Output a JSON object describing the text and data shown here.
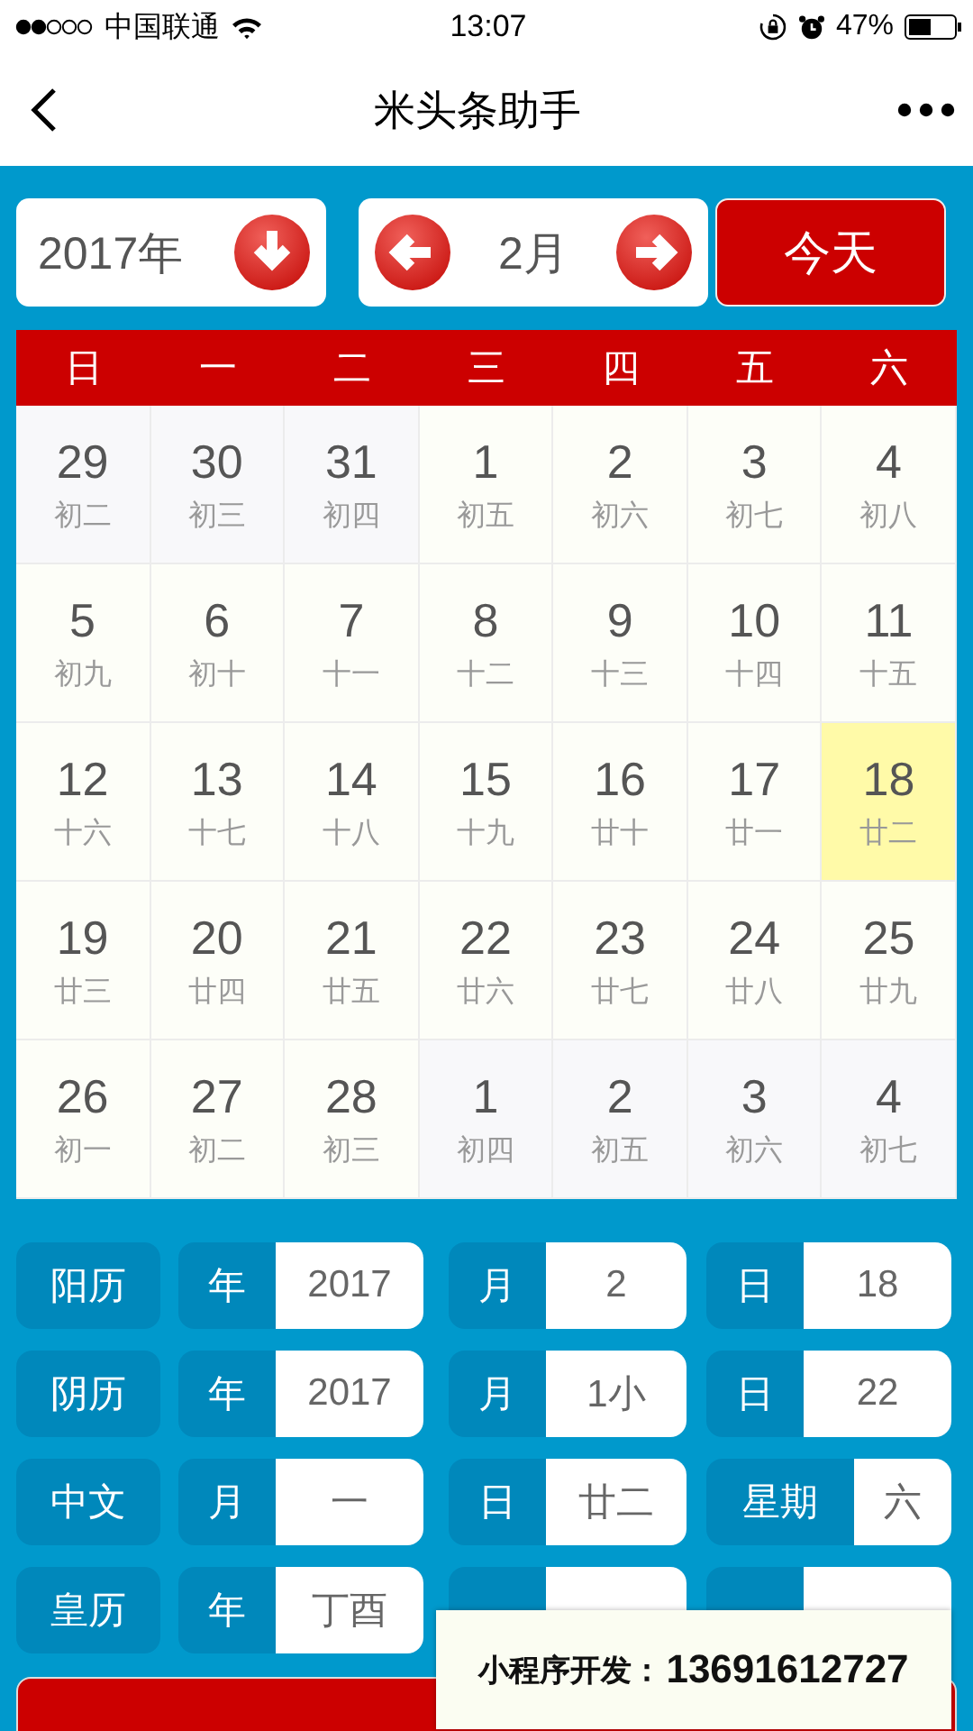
{
  "status_bar": {
    "carrier": "中国联通",
    "time": "13:07",
    "battery": "47%"
  },
  "nav": {
    "title": "米头条助手"
  },
  "controls": {
    "year": "2017年",
    "month": "2月",
    "today_button": "今天"
  },
  "weekdays": [
    "日",
    "一",
    "二",
    "三",
    "四",
    "五",
    "六"
  ],
  "days": [
    {
      "day": "29",
      "lunar": "初二",
      "kind": "other",
      "selected": false
    },
    {
      "day": "30",
      "lunar": "初三",
      "kind": "other",
      "selected": false
    },
    {
      "day": "31",
      "lunar": "初四",
      "kind": "other",
      "selected": false
    },
    {
      "day": "1",
      "lunar": "初五",
      "kind": "current",
      "selected": false
    },
    {
      "day": "2",
      "lunar": "初六",
      "kind": "current",
      "selected": false
    },
    {
      "day": "3",
      "lunar": "初七",
      "kind": "current",
      "selected": false
    },
    {
      "day": "4",
      "lunar": "初八",
      "kind": "current",
      "selected": false
    },
    {
      "day": "5",
      "lunar": "初九",
      "kind": "current",
      "selected": false
    },
    {
      "day": "6",
      "lunar": "初十",
      "kind": "current",
      "selected": false
    },
    {
      "day": "7",
      "lunar": "十一",
      "kind": "current",
      "selected": false
    },
    {
      "day": "8",
      "lunar": "十二",
      "kind": "current",
      "selected": false
    },
    {
      "day": "9",
      "lunar": "十三",
      "kind": "current",
      "selected": false
    },
    {
      "day": "10",
      "lunar": "十四",
      "kind": "current",
      "selected": false
    },
    {
      "day": "11",
      "lunar": "十五",
      "kind": "current",
      "selected": false
    },
    {
      "day": "12",
      "lunar": "十六",
      "kind": "current",
      "selected": false
    },
    {
      "day": "13",
      "lunar": "十七",
      "kind": "current",
      "selected": false
    },
    {
      "day": "14",
      "lunar": "十八",
      "kind": "current",
      "selected": false
    },
    {
      "day": "15",
      "lunar": "十九",
      "kind": "current",
      "selected": false
    },
    {
      "day": "16",
      "lunar": "廿十",
      "kind": "current",
      "selected": false
    },
    {
      "day": "17",
      "lunar": "廿一",
      "kind": "current",
      "selected": false
    },
    {
      "day": "18",
      "lunar": "廿二",
      "kind": "current",
      "selected": true
    },
    {
      "day": "19",
      "lunar": "廿三",
      "kind": "current",
      "selected": false
    },
    {
      "day": "20",
      "lunar": "廿四",
      "kind": "current",
      "selected": false
    },
    {
      "day": "21",
      "lunar": "廿五",
      "kind": "current",
      "selected": false
    },
    {
      "day": "22",
      "lunar": "廿六",
      "kind": "current",
      "selected": false
    },
    {
      "day": "23",
      "lunar": "廿七",
      "kind": "current",
      "selected": false
    },
    {
      "day": "24",
      "lunar": "廿八",
      "kind": "current",
      "selected": false
    },
    {
      "day": "25",
      "lunar": "廿九",
      "kind": "current",
      "selected": false
    },
    {
      "day": "26",
      "lunar": "初一",
      "kind": "current",
      "selected": false
    },
    {
      "day": "27",
      "lunar": "初二",
      "kind": "current",
      "selected": false
    },
    {
      "day": "28",
      "lunar": "初三",
      "kind": "current",
      "selected": false
    },
    {
      "day": "1",
      "lunar": "初四",
      "kind": "other",
      "selected": false
    },
    {
      "day": "2",
      "lunar": "初五",
      "kind": "other",
      "selected": false
    },
    {
      "day": "3",
      "lunar": "初六",
      "kind": "other",
      "selected": false
    },
    {
      "day": "4",
      "lunar": "初七",
      "kind": "other",
      "selected": false
    }
  ],
  "info_rows": [
    {
      "label": "阳历",
      "fields": [
        {
          "label": "年",
          "value": "2017"
        },
        {
          "label": "月",
          "value": "2"
        },
        {
          "label": "日",
          "value": "18"
        }
      ]
    },
    {
      "label": "阴历",
      "fields": [
        {
          "label": "年",
          "value": "2017"
        },
        {
          "label": "月",
          "value": "1小"
        },
        {
          "label": "日",
          "value": "22"
        }
      ]
    },
    {
      "label": "中文",
      "fields": [
        {
          "label": "月",
          "value": "一"
        },
        {
          "label": "日",
          "value": "廿二"
        },
        {
          "label": "星期",
          "value": "六"
        }
      ]
    },
    {
      "label": "皇历",
      "fields": [
        {
          "label": "年",
          "value": "丁酉"
        }
      ]
    }
  ],
  "overlay_note": {
    "label": "小程序开发：",
    "number": "13691612727"
  }
}
